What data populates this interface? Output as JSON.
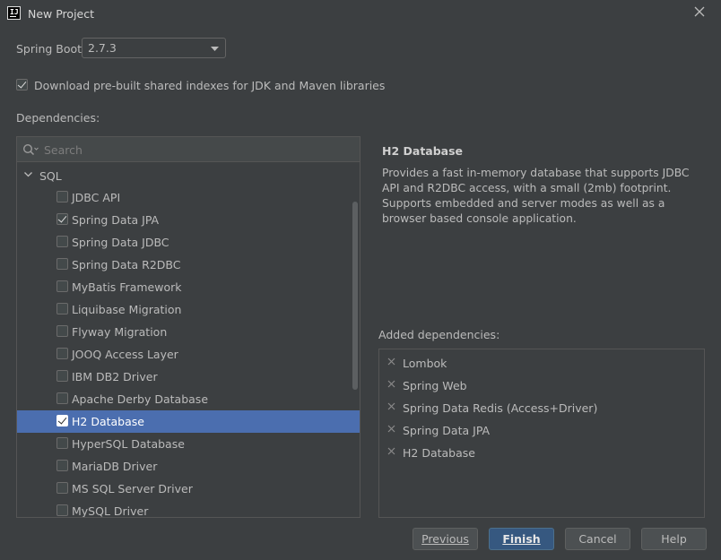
{
  "window": {
    "title": "New Project"
  },
  "spring_boot": {
    "label": "Spring Boot:",
    "value": "2.7.3"
  },
  "shared_indexes": {
    "checked": true,
    "label": "Download pre-built shared indexes for JDK and Maven libraries"
  },
  "dependencies": {
    "label": "Dependencies:",
    "search_placeholder": "Search",
    "group": "SQL",
    "items": [
      {
        "label": "JDBC API",
        "checked": false
      },
      {
        "label": "Spring Data JPA",
        "checked": true
      },
      {
        "label": "Spring Data JDBC",
        "checked": false
      },
      {
        "label": "Spring Data R2DBC",
        "checked": false
      },
      {
        "label": "MyBatis Framework",
        "checked": false
      },
      {
        "label": "Liquibase Migration",
        "checked": false
      },
      {
        "label": "Flyway Migration",
        "checked": false
      },
      {
        "label": "JOOQ Access Layer",
        "checked": false
      },
      {
        "label": "IBM DB2 Driver",
        "checked": false
      },
      {
        "label": "Apache Derby Database",
        "checked": false
      },
      {
        "label": "H2 Database",
        "checked": true,
        "selected": true
      },
      {
        "label": "HyperSQL Database",
        "checked": false
      },
      {
        "label": "MariaDB Driver",
        "checked": false
      },
      {
        "label": "MS SQL Server Driver",
        "checked": false
      },
      {
        "label": "MySQL Driver",
        "checked": false
      }
    ]
  },
  "detail": {
    "title": "H2 Database",
    "description": "Provides a fast in-memory database that supports JDBC API and R2DBC access, with a small (2mb) footprint. Supports embedded and server modes as well as a browser based console application."
  },
  "added": {
    "label": "Added dependencies:",
    "items": [
      "Lombok",
      "Spring Web",
      "Spring Data Redis (Access+Driver)",
      "Spring Data JPA",
      "H2 Database"
    ]
  },
  "buttons": {
    "previous": "Previous",
    "finish": "Finish",
    "cancel": "Cancel",
    "help": "Help"
  },
  "colors": {
    "background": "#3c3f41",
    "selection": "#4b6eaf",
    "primary_button": "#365880"
  }
}
